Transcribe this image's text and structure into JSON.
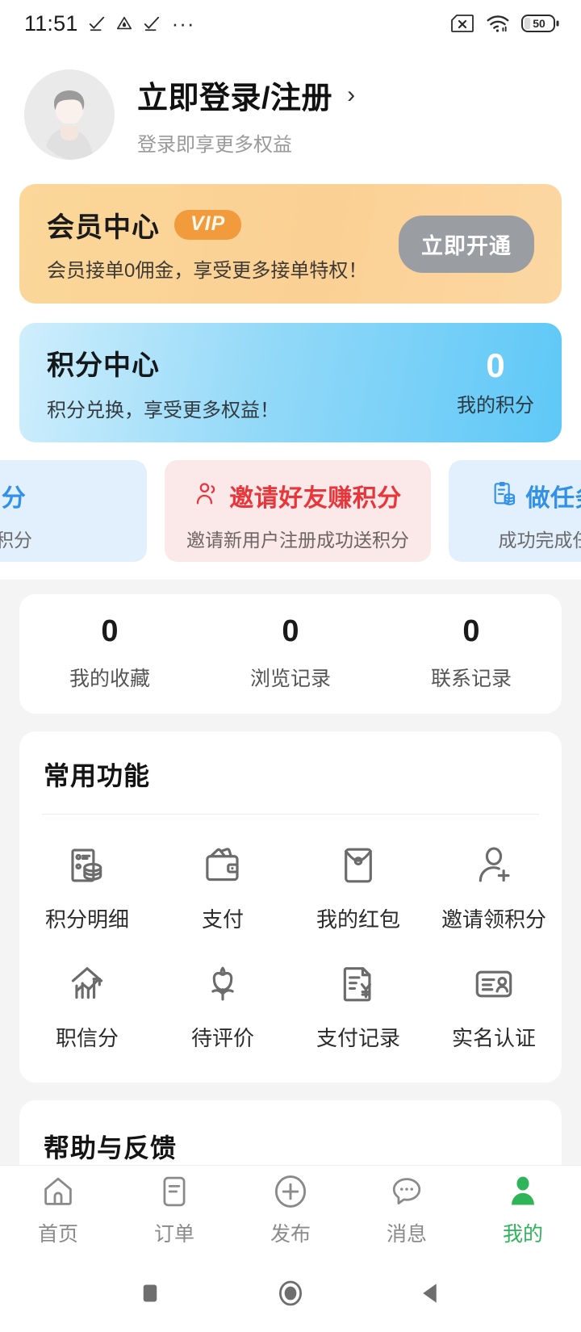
{
  "statusbar": {
    "time": "11:51",
    "overflow_dots": "···",
    "battery_level": "50",
    "icons": [
      "check-upload-icon",
      "triangle-drop-icon",
      "check-upload-icon",
      "more-dots-icon",
      "sim-card-off-icon",
      "wifi-icon",
      "battery-icon"
    ]
  },
  "profile": {
    "login_title": "立即登录/注册",
    "chevron": "›",
    "login_sub": "登录即享更多权益"
  },
  "vip_card": {
    "title": "会员中心",
    "badge": "VIP",
    "subtitle": "会员接单0佣金，享受更多接单特权！",
    "button": "立即开通",
    "bg_color": "#fbd094",
    "badge_color": "#f29b3d",
    "button_color": "#9a9ea3"
  },
  "points_card": {
    "title": "积分中心",
    "subtitle": "积分兑换，享受更多权益！",
    "value": "0",
    "value_label": "我的积分",
    "bg_color": "#5ec8f7"
  },
  "earn_cards": [
    {
      "title": "分",
      "subtitle": "积分",
      "style": "blue",
      "icon": "",
      "color": "#3190e8"
    },
    {
      "title": "邀请好友赚积分",
      "subtitle": "邀请新用户注册成功送积分",
      "style": "pink",
      "icon": "invite-person-icon",
      "color": "#e8363a"
    },
    {
      "title": "做任务赚积分",
      "subtitle": "成功完成任务送积分",
      "style": "blue",
      "icon": "task-coins-icon",
      "color": "#3190e8"
    }
  ],
  "stats": [
    {
      "value": "0",
      "label": "我的收藏"
    },
    {
      "value": "0",
      "label": "浏览记录"
    },
    {
      "value": "0",
      "label": "联系记录"
    }
  ],
  "functions": {
    "title": "常用功能",
    "items": [
      {
        "label": "积分明细",
        "icon": "points-detail-icon"
      },
      {
        "label": "支付",
        "icon": "wallet-icon"
      },
      {
        "label": "我的红包",
        "icon": "red-packet-icon"
      },
      {
        "label": "邀请领积分",
        "icon": "add-person-icon"
      },
      {
        "label": "职信分",
        "icon": "growth-chart-icon"
      },
      {
        "label": "待评价",
        "icon": "flower-icon"
      },
      {
        "label": "支付记录",
        "icon": "invoice-yuan-icon"
      },
      {
        "label": "实名认证",
        "icon": "id-card-icon"
      }
    ]
  },
  "help": {
    "title": "帮助与反馈"
  },
  "tabbar": {
    "active_color": "#2fb45a",
    "inactive_color": "#8a8a8a",
    "items": [
      {
        "label": "首页",
        "icon": "home-icon",
        "active": false
      },
      {
        "label": "订单",
        "icon": "order-list-icon",
        "active": false
      },
      {
        "label": "发布",
        "icon": "plus-circle-icon",
        "active": false
      },
      {
        "label": "消息",
        "icon": "chat-bubble-icon",
        "active": false
      },
      {
        "label": "我的",
        "icon": "person-icon",
        "active": true
      }
    ]
  },
  "androidnav": {
    "buttons": [
      "recents-square-icon",
      "home-circle-icon",
      "back-triangle-icon"
    ]
  }
}
